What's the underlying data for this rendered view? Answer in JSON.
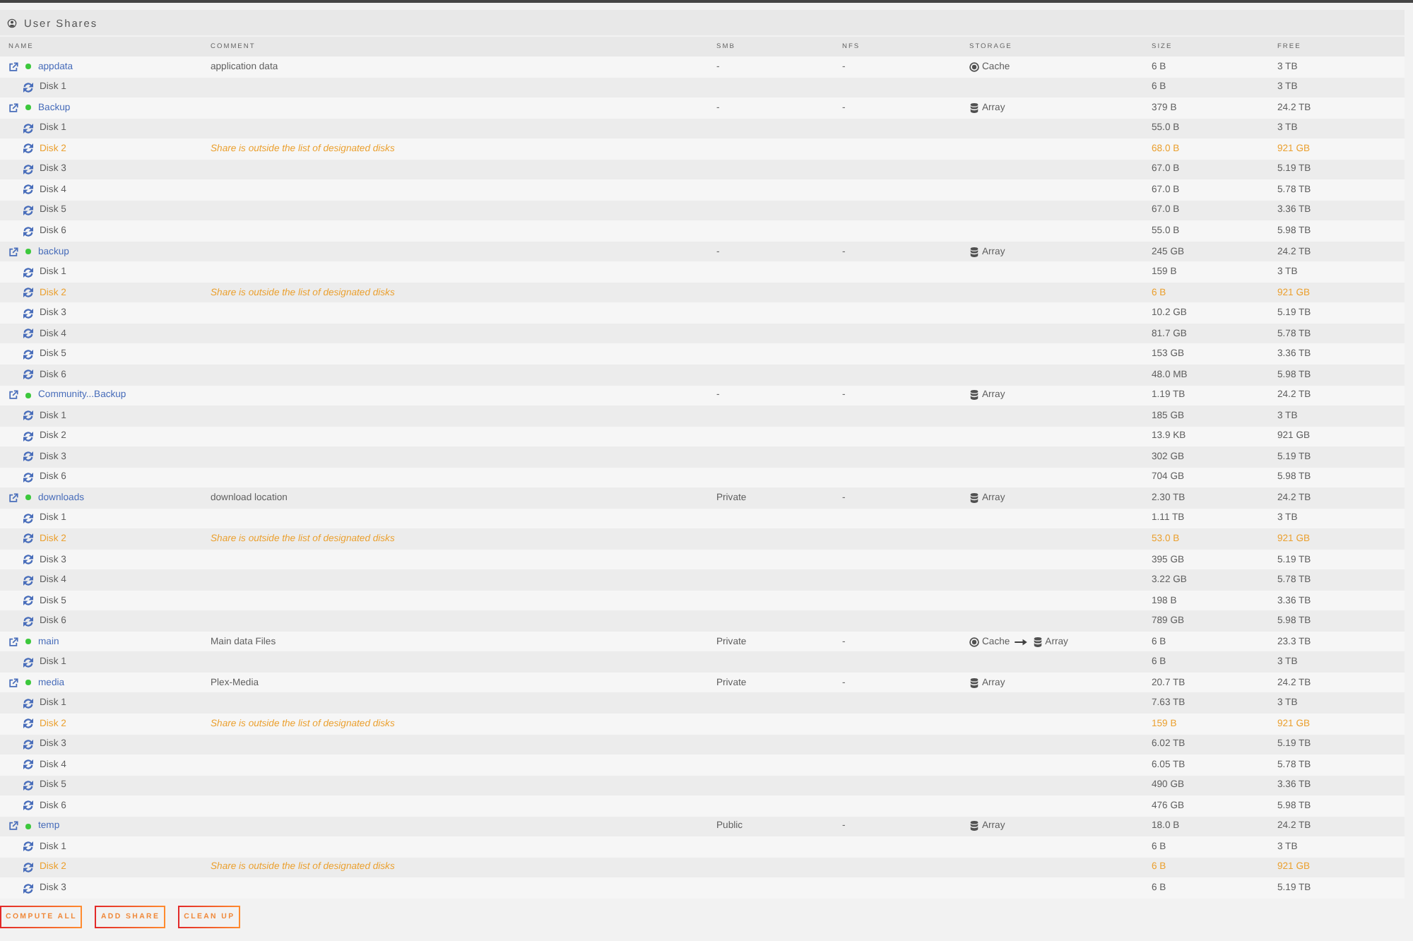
{
  "panel": {
    "title": "User Shares"
  },
  "table": {
    "columns": [
      "NAME",
      "COMMENT",
      "SMB",
      "NFS",
      "STORAGE",
      "SIZE",
      "FREE"
    ],
    "shares": [
      {
        "name": "appdata",
        "color": "#3cc83c",
        "comment": "application data",
        "smb": "-",
        "nfs": "-",
        "storage": [
          {
            "kind": "cache",
            "label": "Cache"
          }
        ],
        "size": "6 B",
        "free": "3 TB",
        "disks": [
          {
            "name": "Disk 1",
            "warning": false,
            "size": "6 B",
            "free": "3 TB"
          }
        ]
      },
      {
        "name": "Backup",
        "color": "#3cc83c",
        "smb": "-",
        "nfs": "-",
        "storage": [
          {
            "kind": "array",
            "label": "Array"
          }
        ],
        "size": "379 B",
        "free": "24.2 TB",
        "disks": [
          {
            "name": "Disk 1",
            "warning": false,
            "size": "55.0 B",
            "free": "3 TB"
          },
          {
            "name": "Disk 2",
            "warning": true,
            "comment": "Share is outside the list of designated disks",
            "size": "68.0 B",
            "free": "921 GB"
          },
          {
            "name": "Disk 3",
            "warning": false,
            "size": "67.0 B",
            "free": "5.19 TB"
          },
          {
            "name": "Disk 4",
            "warning": false,
            "size": "67.0 B",
            "free": "5.78 TB"
          },
          {
            "name": "Disk 5",
            "warning": false,
            "size": "67.0 B",
            "free": "3.36 TB"
          },
          {
            "name": "Disk 6",
            "warning": false,
            "size": "55.0 B",
            "free": "5.98 TB"
          }
        ]
      },
      {
        "name": "backup",
        "color": "#3cc83c",
        "smb": "-",
        "nfs": "-",
        "storage": [
          {
            "kind": "array",
            "label": "Array"
          }
        ],
        "size": "245 GB",
        "free": "24.2 TB",
        "disks": [
          {
            "name": "Disk 1",
            "warning": false,
            "size": "159 B",
            "free": "3 TB"
          },
          {
            "name": "Disk 2",
            "warning": true,
            "comment": "Share is outside the list of designated disks",
            "size": "6 B",
            "free": "921 GB"
          },
          {
            "name": "Disk 3",
            "warning": false,
            "size": "10.2 GB",
            "free": "5.19 TB"
          },
          {
            "name": "Disk 4",
            "warning": false,
            "size": "81.7 GB",
            "free": "5.78 TB"
          },
          {
            "name": "Disk 5",
            "warning": false,
            "size": "153 GB",
            "free": "3.36 TB"
          },
          {
            "name": "Disk 6",
            "warning": false,
            "size": "48.0 MB",
            "free": "5.98 TB"
          }
        ]
      },
      {
        "name": "Community...Backup",
        "color": "#3cc83c",
        "smb": "-",
        "nfs": "-",
        "storage": [
          {
            "kind": "array",
            "label": "Array"
          }
        ],
        "size": "1.19 TB",
        "free": "24.2 TB",
        "disks": [
          {
            "name": "Disk 1",
            "warning": false,
            "size": "185 GB",
            "free": "3 TB"
          },
          {
            "name": "Disk 2",
            "warning": false,
            "size": "13.9 KB",
            "free": "921 GB"
          },
          {
            "name": "Disk 3",
            "warning": false,
            "size": "302 GB",
            "free": "5.19 TB"
          },
          {
            "name": "Disk 6",
            "warning": false,
            "size": "704 GB",
            "free": "5.98 TB"
          }
        ]
      },
      {
        "name": "downloads",
        "color": "#3cc83c",
        "comment": "download location",
        "smb": "Private",
        "nfs": "-",
        "storage": [
          {
            "kind": "array",
            "label": "Array"
          }
        ],
        "size": "2.30 TB",
        "free": "24.2 TB",
        "disks": [
          {
            "name": "Disk 1",
            "warning": false,
            "size": "1.11 TB",
            "free": "3 TB"
          },
          {
            "name": "Disk 2",
            "warning": true,
            "comment": "Share is outside the list of designated disks",
            "size": "53.0 B",
            "free": "921 GB"
          },
          {
            "name": "Disk 3",
            "warning": false,
            "size": "395 GB",
            "free": "5.19 TB"
          },
          {
            "name": "Disk 4",
            "warning": false,
            "size": "3.22 GB",
            "free": "5.78 TB"
          },
          {
            "name": "Disk 5",
            "warning": false,
            "size": "198 B",
            "free": "3.36 TB"
          },
          {
            "name": "Disk 6",
            "warning": false,
            "size": "789 GB",
            "free": "5.98 TB"
          }
        ]
      },
      {
        "name": "main",
        "color": "#3cc83c",
        "comment": "Main data Files",
        "smb": "Private",
        "nfs": "-",
        "storage": [
          {
            "kind": "cache",
            "label": "Cache"
          },
          {
            "kind": "array",
            "label": "Array"
          }
        ],
        "size": "6 B",
        "free": "23.3 TB",
        "disks": [
          {
            "name": "Disk 1",
            "warning": false,
            "size": "6 B",
            "free": "3 TB"
          }
        ]
      },
      {
        "name": "media",
        "color": "#3cc83c",
        "comment": "Plex-Media",
        "smb": "Private",
        "nfs": "-",
        "storage": [
          {
            "kind": "array",
            "label": "Array"
          }
        ],
        "size": "20.7 TB",
        "free": "24.2 TB",
        "disks": [
          {
            "name": "Disk 1",
            "warning": false,
            "size": "7.63 TB",
            "free": "3 TB"
          },
          {
            "name": "Disk 2",
            "warning": true,
            "comment": "Share is outside the list of designated disks",
            "size": "159 B",
            "free": "921 GB"
          },
          {
            "name": "Disk 3",
            "warning": false,
            "size": "6.02 TB",
            "free": "5.19 TB"
          },
          {
            "name": "Disk 4",
            "warning": false,
            "size": "6.05 TB",
            "free": "5.78 TB"
          },
          {
            "name": "Disk 5",
            "warning": false,
            "size": "490 GB",
            "free": "3.36 TB"
          },
          {
            "name": "Disk 6",
            "warning": false,
            "size": "476 GB",
            "free": "5.98 TB"
          }
        ]
      },
      {
        "name": "temp",
        "color": "#3cc83c",
        "smb": "Public",
        "nfs": "-",
        "storage": [
          {
            "kind": "array",
            "label": "Array"
          }
        ],
        "size": "18.0 B",
        "free": "24.2 TB",
        "disks": [
          {
            "name": "Disk 1",
            "warning": false,
            "size": "6 B",
            "free": "3 TB"
          },
          {
            "name": "Disk 2",
            "warning": true,
            "comment": "Share is outside the list of designated disks",
            "size": "6 B",
            "free": "921 GB"
          },
          {
            "name": "Disk 3",
            "warning": false,
            "size": "6 B",
            "free": "5.19 TB"
          }
        ]
      }
    ]
  },
  "buttons": [
    "COMPUTE ALL",
    "ADD SHARE",
    "CLEAN UP"
  ]
}
